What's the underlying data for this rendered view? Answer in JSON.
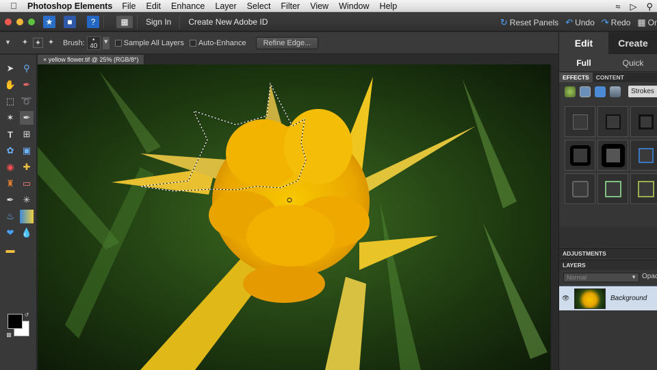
{
  "menubar": {
    "app_name": "Photoshop Elements",
    "items": [
      "File",
      "Edit",
      "Enhance",
      "Layer",
      "Select",
      "Filter",
      "View",
      "Window",
      "Help"
    ]
  },
  "titlebar": {
    "sign_in": "Sign In",
    "create_id": "Create New Adobe ID",
    "reset_panels": "Reset Panels",
    "undo": "Undo",
    "redo": "Redo",
    "organizer": "Or"
  },
  "options": {
    "brush_label": "Brush:",
    "brush_size": "40",
    "sample_all_layers": "Sample All Layers",
    "auto_enhance": "Auto-Enhance",
    "refine_edge": "Refine Edge..."
  },
  "document": {
    "tab_title": "yellow flower.tif @ 25% (RGB/8*)"
  },
  "panel": {
    "mode_tabs": [
      "Edit",
      "Create"
    ],
    "sub_tabs": [
      "Full",
      "Quick"
    ],
    "effects_tab": "EFFECTS",
    "content_tab": "CONTENT",
    "strokes_select": "Strokes",
    "adjustments": "ADJUSTMENTS",
    "layers": "LAYERS",
    "blend_mode": "Normal",
    "opacity_label": "Opac",
    "layer_name": "Background"
  },
  "colors": {
    "selection": "#f0c000",
    "accent_blue": "#4ea2ff"
  }
}
